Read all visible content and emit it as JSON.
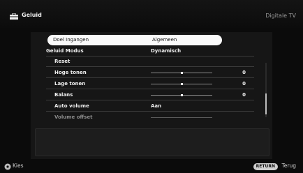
{
  "header": {
    "title": "Geluid",
    "source": "Digitale TV",
    "icon": "toolbox-icon"
  },
  "menu": [
    {
      "id": "doel-ingangen",
      "label": "Doel Ingangen",
      "value": "Algemeen"
    },
    {
      "id": "geluid-modus",
      "label": "Geluid Modus",
      "value": "Dynamisch"
    },
    {
      "id": "reset",
      "label": "Reset"
    },
    {
      "id": "hoge-tonen",
      "label": "Hoge tonen",
      "value": "0",
      "level": 0.5
    },
    {
      "id": "lage-tonen",
      "label": "Lage tonen",
      "value": "0",
      "level": 0.5
    },
    {
      "id": "balans",
      "label": "Balans",
      "value": "0",
      "level": 0.5
    },
    {
      "id": "auto-volume",
      "label": "Auto volume",
      "value": "Aan"
    },
    {
      "id": "volume-offset",
      "label": "Volume offset",
      "level": null
    }
  ],
  "footer": {
    "select_label": "Kies",
    "return_button": "RETURN",
    "back_label": "Terug"
  },
  "colors": {
    "background": "#0b0b0b",
    "highlight": "#fafafa",
    "text": "#efefef",
    "dim": "#8d8d8d"
  }
}
